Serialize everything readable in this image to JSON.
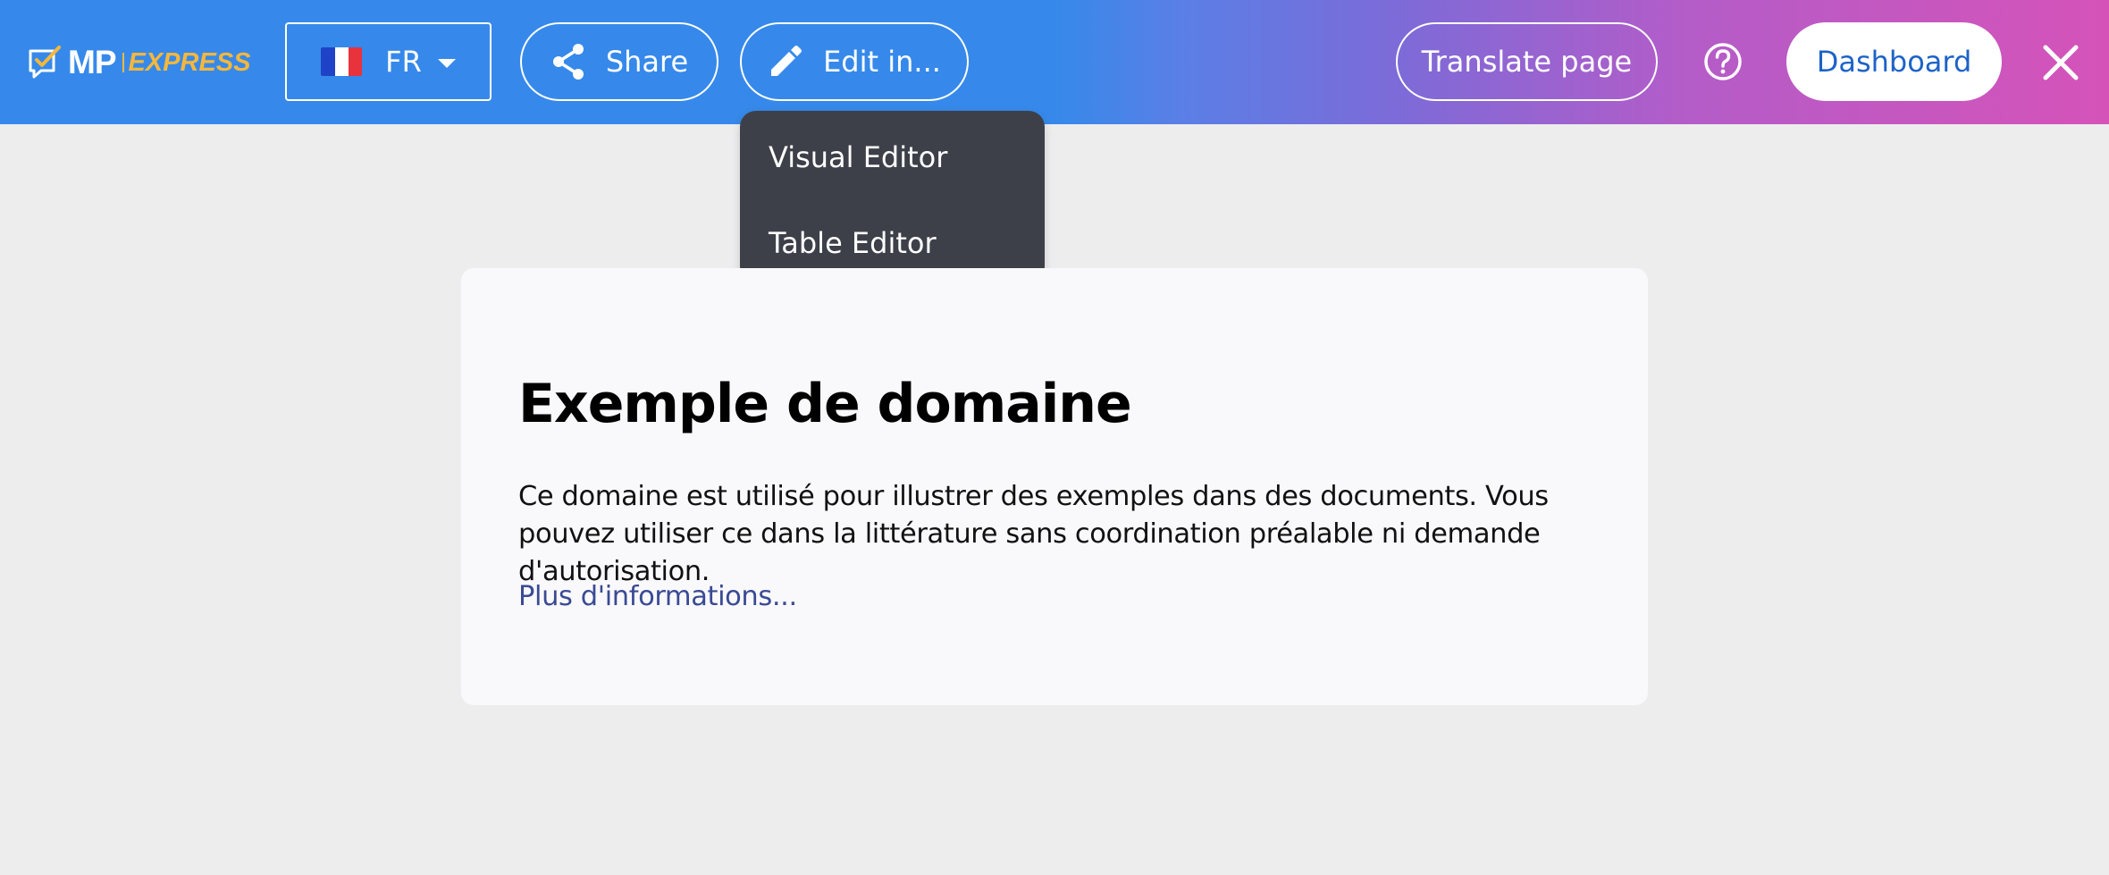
{
  "topbar": {
    "logo": {
      "mp": "MP",
      "express": "EXPRESS"
    },
    "language": {
      "code": "FR",
      "flag_colors": [
        "#1f43c7",
        "#ffffff",
        "#e8323c"
      ]
    },
    "share_label": "Share",
    "edit_label": "Edit in...",
    "translate_label": "Translate page",
    "dashboard_label": "Dashboard",
    "icons": {
      "share": "share-icon",
      "edit": "pencil-icon",
      "help": "help-circle-icon",
      "close": "close-icon",
      "logo": "chat-check-icon"
    }
  },
  "edit_menu": {
    "items": [
      {
        "label": "Visual Editor"
      },
      {
        "label": "Table Editor"
      }
    ]
  },
  "content": {
    "title": "Exemple de domaine",
    "paragraph": "Ce domaine est utilisé pour illustrer des exemples dans des documents. Vous pouvez utiliser ce dans la littérature sans coordination préalable ni demande d'autorisation.",
    "link": "Plus d'informations..."
  },
  "colors": {
    "topbar_start": "#3689ea",
    "topbar_end": "#d553b9",
    "accent_gold": "#f4b73d",
    "dashboard_text": "#1d63c8",
    "menu_bg": "#3d4049",
    "page_bg": "#ededee",
    "card_bg": "#f9f9fb",
    "link": "#3a4a93"
  }
}
